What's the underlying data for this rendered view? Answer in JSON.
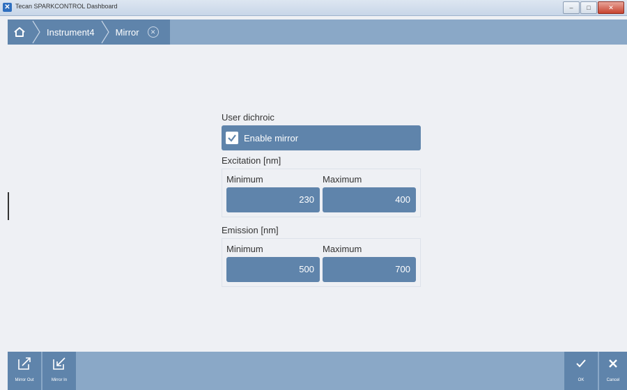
{
  "window": {
    "title": "Tecan SPARKCONTROL Dashboard",
    "minimize": "–",
    "maximize": "□",
    "close": "✕"
  },
  "breadcrumb": {
    "items": [
      "Instrument4",
      "Mirror"
    ],
    "close_glyph": "✕"
  },
  "form": {
    "user_dichroic_label": "User dichroic",
    "enable_mirror_label": "Enable mirror",
    "enable_mirror_checked": true,
    "excitation": {
      "label": "Excitation [nm]",
      "min_label": "Minimum",
      "max_label": "Maximum",
      "min_value": "230",
      "max_value": "400"
    },
    "emission": {
      "label": "Emission [nm]",
      "min_label": "Minimum",
      "max_label": "Maximum",
      "min_value": "500",
      "max_value": "700"
    }
  },
  "toolbar": {
    "mirror_out_label": "Mirror Out",
    "mirror_in_label": "Mirror In",
    "ok_label": "OK",
    "cancel_label": "Cancel"
  },
  "colors": {
    "accent": "#5f84ab",
    "bar": "#8aa8c7",
    "background": "#eef0f4"
  }
}
